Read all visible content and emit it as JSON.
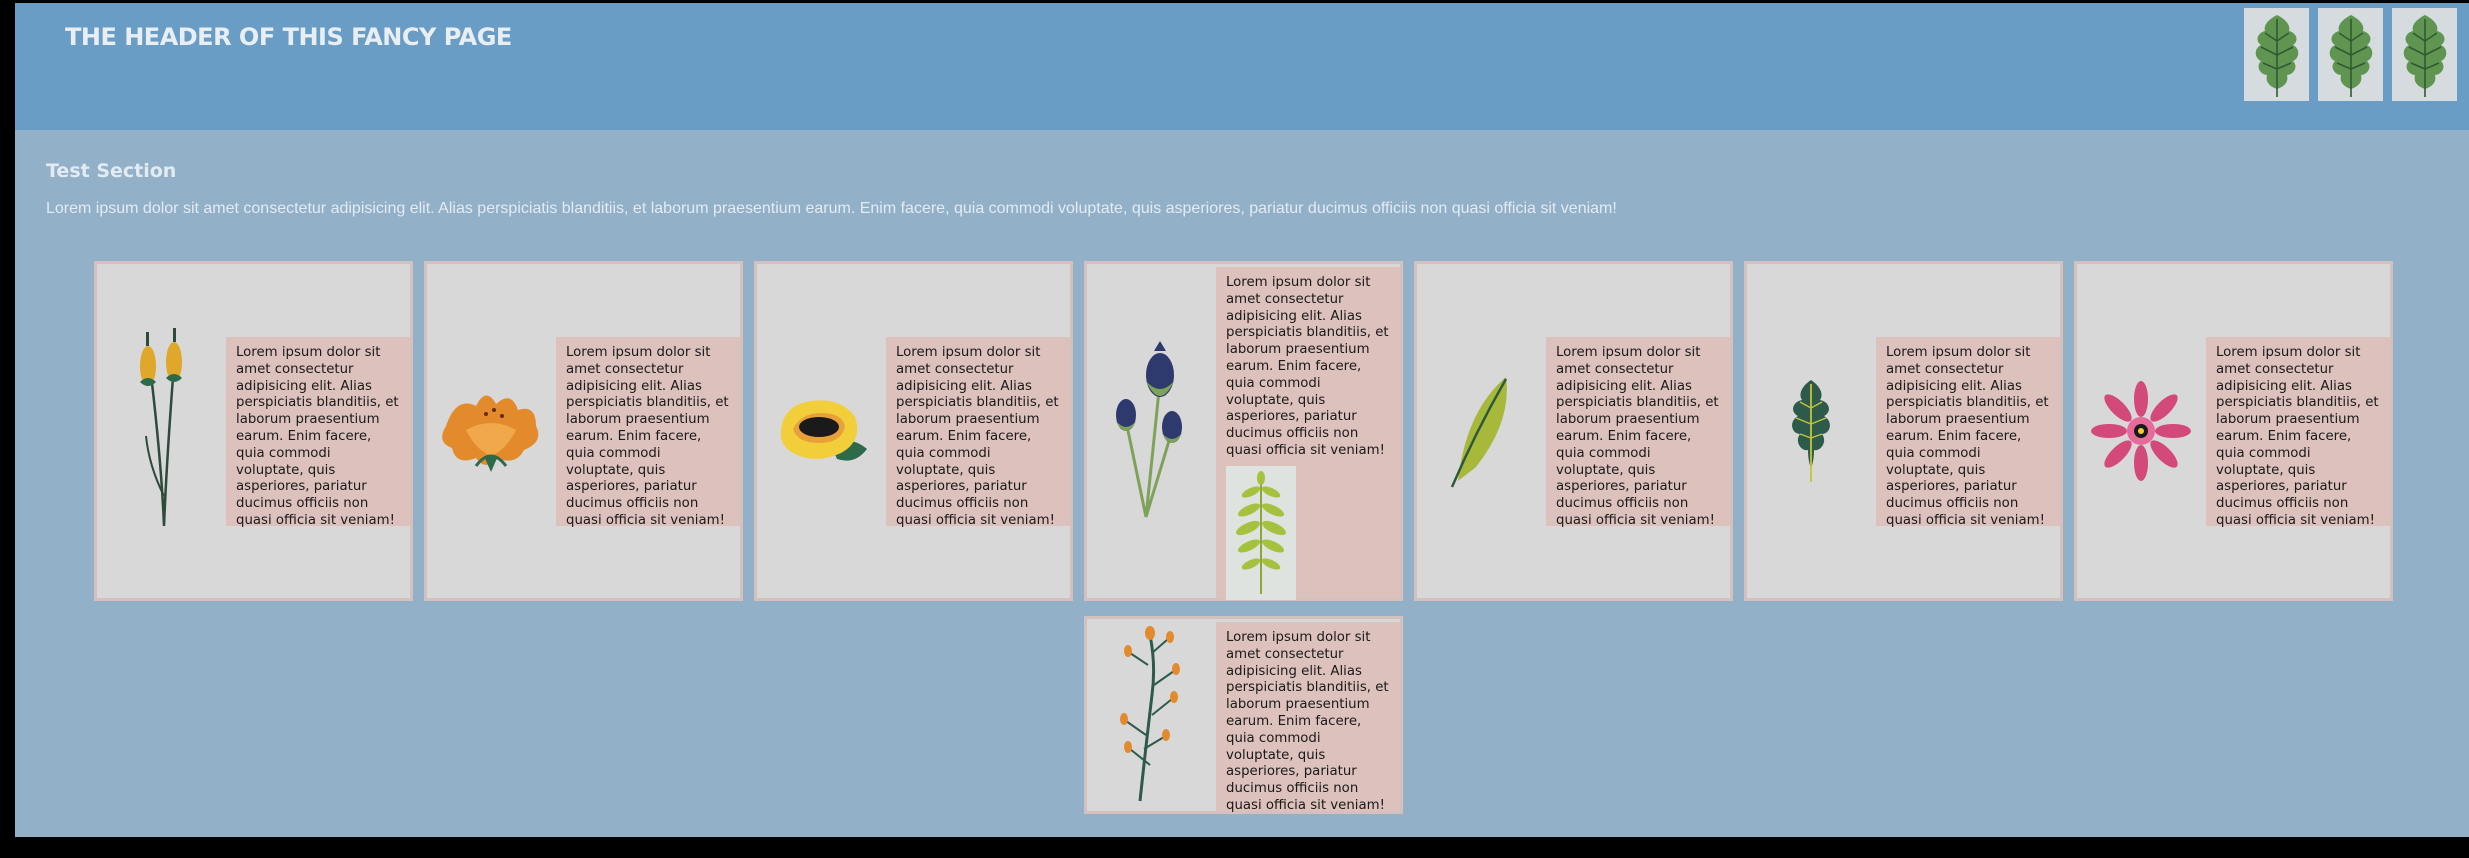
{
  "header": {
    "title": "THE HEADER OF THIS FANCY PAGE",
    "leaf_icons": [
      "oak-leaf-icon",
      "oak-leaf-icon",
      "oak-leaf-icon"
    ]
  },
  "section": {
    "title": "Test Section",
    "intro": "Lorem ipsum dolor sit amet consectetur adipisicing elit. Alias perspiciatis blanditiis, et laborum praesentium earum. Enim facere, quia commodi voluptate, quis asperiores, pariatur ducimus officiis non quasi officia sit veniam!"
  },
  "cards": [
    {
      "image": "yellow-tulip-buds-icon",
      "text": "Lorem ipsum dolor sit amet consectetur adipisicing elit. Alias perspiciatis blanditiis, et laborum praesentium earum. Enim facere, quia commodi voluptate, quis asperiores, pariatur ducimus officiis non quasi officia sit veniam!"
    },
    {
      "image": "orange-carnation-icon",
      "text": "Lorem ipsum dolor sit amet consectetur adipisicing elit. Alias perspiciatis blanditiis, et laborum praesentium earum. Enim facere, quia commodi voluptate, quis asperiores, pariatur ducimus officiis non quasi officia sit veniam!"
    },
    {
      "image": "yellow-rose-icon",
      "text": "Lorem ipsum dolor sit amet consectetur adipisicing elit. Alias perspiciatis blanditiis, et laborum praesentium earum. Enim facere, quia commodi voluptate, quis asperiores, pariatur ducimus officiis non quasi officia sit veniam!"
    },
    {
      "image": "blue-thistle-icon",
      "text": "Lorem ipsum dolor sit amet consectetur adipisicing elit. Alias perspiciatis blanditiis, et laborum praesentium earum. Enim facere, quia commodi voluptate, quis asperiores, pariatur ducimus officiis non quasi officia sit veniam!",
      "extra_image": "fern-sprig-icon"
    },
    {
      "image": "green-leaf-icon",
      "text": "Lorem ipsum dolor sit amet consectetur adipisicing elit. Alias perspiciatis blanditiis, et laborum praesentium earum. Enim facere, quia commodi voluptate, quis asperiores, pariatur ducimus officiis non quasi officia sit veniam!"
    },
    {
      "image": "dark-oak-leaf-icon",
      "text": "Lorem ipsum dolor sit amet consectetur adipisicing elit. Alias perspiciatis blanditiis, et laborum praesentium earum. Enim facere, quia commodi voluptate, quis asperiores, pariatur ducimus officiis non quasi officia sit veniam!"
    },
    {
      "image": "pink-daisy-icon",
      "text": "Lorem ipsum dolor sit amet consectetur adipisicing elit. Alias perspiciatis blanditiis, et laborum praesentium earum. Enim facere, quia commodi voluptate, quis asperiores, pariatur ducimus officiis non quasi officia sit veniam!"
    },
    {
      "image": "orange-berry-sprig-icon",
      "text": "Lorem ipsum dolor sit amet consectetur adipisicing elit. Alias perspiciatis blanditiis, et laborum praesentium earum. Enim facere, quia commodi voluptate, quis asperiores, pariatur ducimus officiis non quasi officia sit veniam!"
    }
  ],
  "colors": {
    "page_background": "#93b0c9",
    "header_background": "#6a9dc6",
    "card_background": "#d8d8d8",
    "card_border": "#d4c0bd",
    "text_panel": "#dcc1bc"
  }
}
